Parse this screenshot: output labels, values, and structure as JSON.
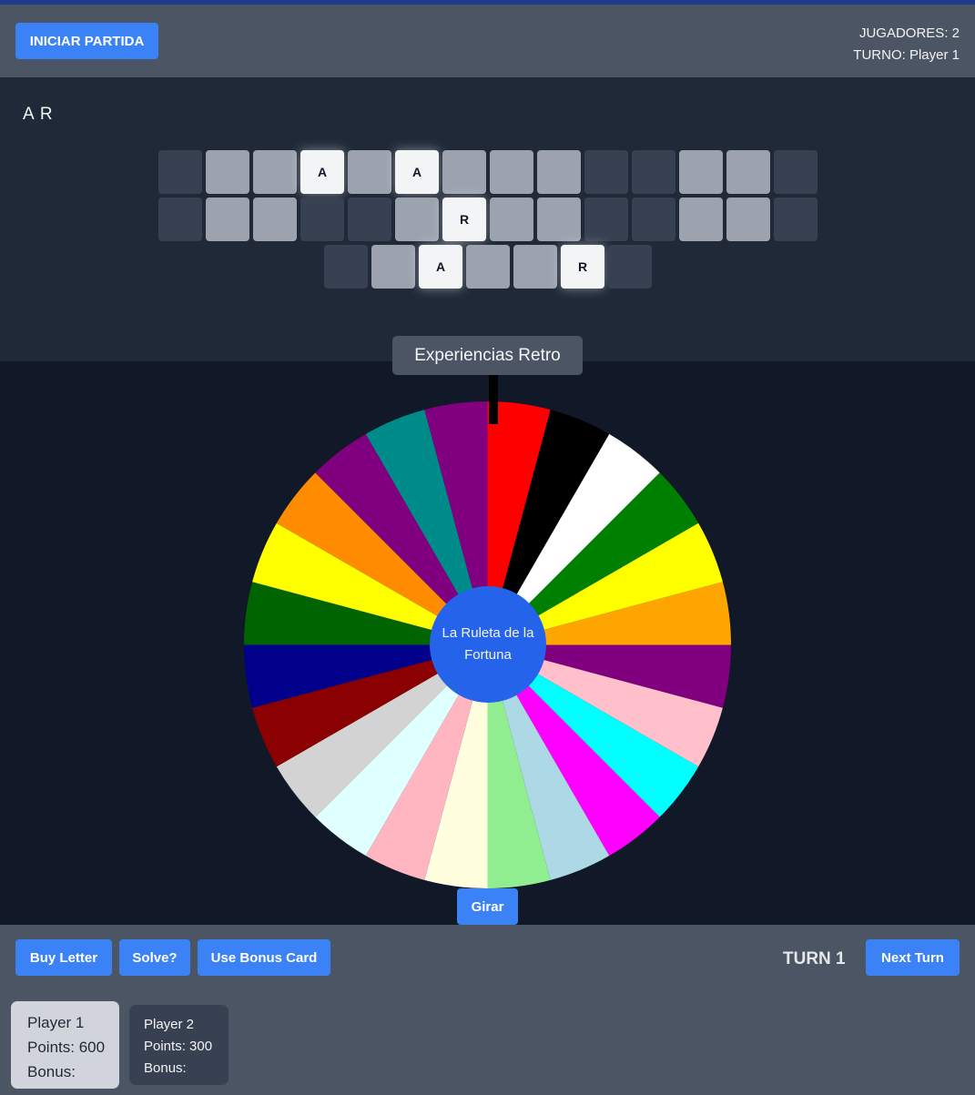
{
  "header": {
    "start_button": "INICIAR PARTIDA",
    "players_text": "JUGADORES: 2",
    "turn_text": "TURNO: Player 1"
  },
  "puzzle": {
    "used_letters": "A R",
    "rows": [
      [
        "",
        "?",
        "?",
        "A",
        "?",
        "A",
        "?",
        "?",
        "?",
        "",
        "",
        "?",
        "?",
        ""
      ],
      [
        "",
        "?",
        "?",
        "",
        "",
        "?",
        "R",
        "?",
        "?",
        "",
        "",
        "?",
        "?",
        ""
      ],
      [
        "",
        "?",
        "A",
        "?",
        "?",
        "R",
        ""
      ]
    ]
  },
  "wheel": {
    "category": "Experiencias Retro",
    "center_label": "La Ruleta de la Fortuna",
    "segment_colors": [
      "#ff0000",
      "#000000",
      "#ffffff",
      "#008000",
      "#ffff00",
      "#ffa500",
      "#800080",
      "#ffc0cb",
      "#00ffff",
      "#ff00ff",
      "#add8e6",
      "#90ee90",
      "#ffffe0",
      "#ffb6c1",
      "#e0ffff",
      "#d3d3d3",
      "#8b0000",
      "#00008b",
      "#006400",
      "#ffff00",
      "#ff8c00",
      "#800080",
      "#008b8b",
      "#800080"
    ],
    "spin_button": "Girar"
  },
  "controls": {
    "buy_letter": "Buy Letter",
    "solve": "Solve?",
    "use_bonus": "Use Bonus Card",
    "turn_label": "TURN 1",
    "next_turn": "Next Turn"
  },
  "players": [
    {
      "name": "Player 1",
      "points": "Points: 600",
      "bonus": "Bonus:"
    },
    {
      "name": "Player 2",
      "points": "Points: 300",
      "bonus": "Bonus:"
    }
  ]
}
